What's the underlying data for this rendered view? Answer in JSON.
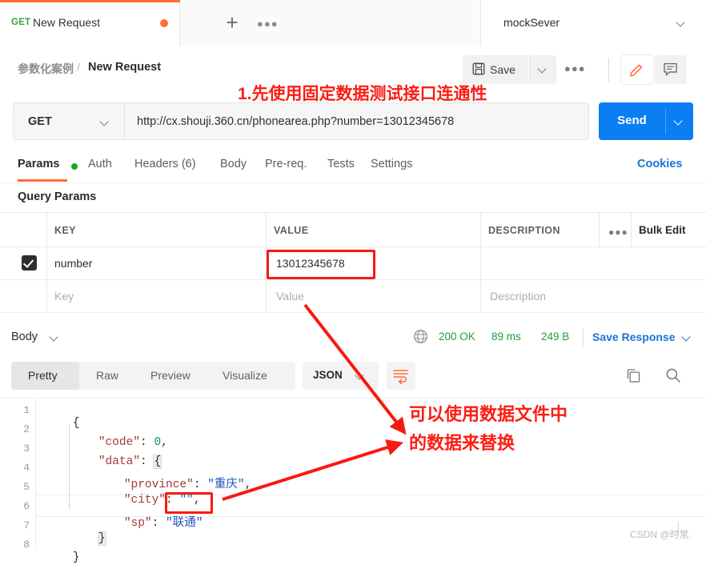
{
  "tabstrip": {
    "active_tab": {
      "method": "GET",
      "title": "New Request",
      "unsaved_icon": "unsaved-dot"
    },
    "new_tab_icon": "plus-icon",
    "more_tabs_icon": "ellipsis-icon",
    "environment": {
      "name": "mockSever",
      "caret_icon": "chevron-down-icon"
    }
  },
  "header": {
    "breadcrumb_root": "参数化案例",
    "breadcrumb_separator": "/",
    "breadcrumb_leaf": "New Request",
    "save_label": "Save",
    "save_icon": "floppy-disk-icon",
    "save_caret_icon": "chevron-down-icon",
    "more_icon": "ellipsis-icon",
    "edit_icon": "pencil-icon",
    "comment_icon": "comment-icon"
  },
  "url_bar": {
    "method": "GET",
    "method_caret_icon": "chevron-down-icon",
    "url": "http://cx.shouji.360.cn/phonearea.php?number=13012345678",
    "send_label": "Send",
    "send_caret_icon": "chevron-down-icon"
  },
  "request_tabs": {
    "items": [
      {
        "label": "Params",
        "active": true,
        "dot": true
      },
      {
        "label": "Auth",
        "active": false
      },
      {
        "label": "Headers (6)",
        "active": false
      },
      {
        "label": "Body",
        "active": false
      },
      {
        "label": "Pre-req.",
        "active": false
      },
      {
        "label": "Tests",
        "active": false
      },
      {
        "label": "Settings",
        "active": false
      }
    ],
    "cookies_label": "Cookies"
  },
  "query_params": {
    "section_title": "Query Params",
    "columns": [
      "KEY",
      "VALUE",
      "DESCRIPTION"
    ],
    "options_icon": "ellipsis-icon",
    "bulk_edit_label": "Bulk Edit",
    "rows": [
      {
        "checked": true,
        "key": "number",
        "value": "13012345678",
        "description": ""
      }
    ],
    "placeholder_row": {
      "key": "Key",
      "value": "Value",
      "description": "Description"
    }
  },
  "response": {
    "body_label": "Body",
    "body_caret_icon": "chevron-down-icon",
    "globe_icon": "globe-icon",
    "status": "200 OK",
    "time": "89 ms",
    "size": "249 B",
    "save_response_label": "Save Response",
    "save_response_caret_icon": "chevron-down-icon",
    "view_tabs": [
      "Pretty",
      "Raw",
      "Preview",
      "Visualize"
    ],
    "active_view_tab": "Pretty",
    "format": "JSON",
    "format_caret_icon": "chevron-down-icon",
    "wrap_icon": "wrap-lines-icon",
    "copy_icon": "copy-icon",
    "search_icon": "search-icon",
    "line_numbers": [
      "1",
      "2",
      "3",
      "4",
      "5",
      "6",
      "7",
      "8"
    ],
    "body_json": {
      "code": 0,
      "data": {
        "province": "重庆",
        "city": "",
        "sp": "联通"
      }
    },
    "code_lines": [
      {
        "no": "1",
        "text": "{"
      },
      {
        "no": "2",
        "key": "\"code\"",
        "sep": ": ",
        "num": "0",
        "tail": ","
      },
      {
        "no": "3",
        "key": "\"data\"",
        "sep": ": ",
        "brace": "{"
      },
      {
        "no": "4",
        "key": "\"province\"",
        "sep": ": ",
        "str": "\"重庆\"",
        "tail": ","
      },
      {
        "no": "5",
        "key": "\"city\"",
        "sep": ": ",
        "str": "\"\"",
        "tail": ","
      },
      {
        "no": "6",
        "key": "\"sp\"",
        "sep": ": ",
        "str": "\"联通\"",
        "tail": ""
      },
      {
        "no": "7",
        "brace": "}"
      },
      {
        "no": "8",
        "text": "}"
      }
    ]
  },
  "annotations": {
    "note_top": "1.先使用固定数据测试接口连通性",
    "note_bottom_line1": "可以使用数据文件中",
    "note_bottom_line2": "的数据来替换",
    "highlight_value": "13012345678",
    "highlight_sp": "\"联通\""
  },
  "watermark": {
    "text": "CSDN @时常."
  },
  "colors": {
    "accent_orange": "#ff6c37",
    "send_blue": "#0b7ef4",
    "link_blue": "#1a73d8",
    "status_green": "#1f9c3a",
    "annotation_red": "#fb1d12"
  }
}
